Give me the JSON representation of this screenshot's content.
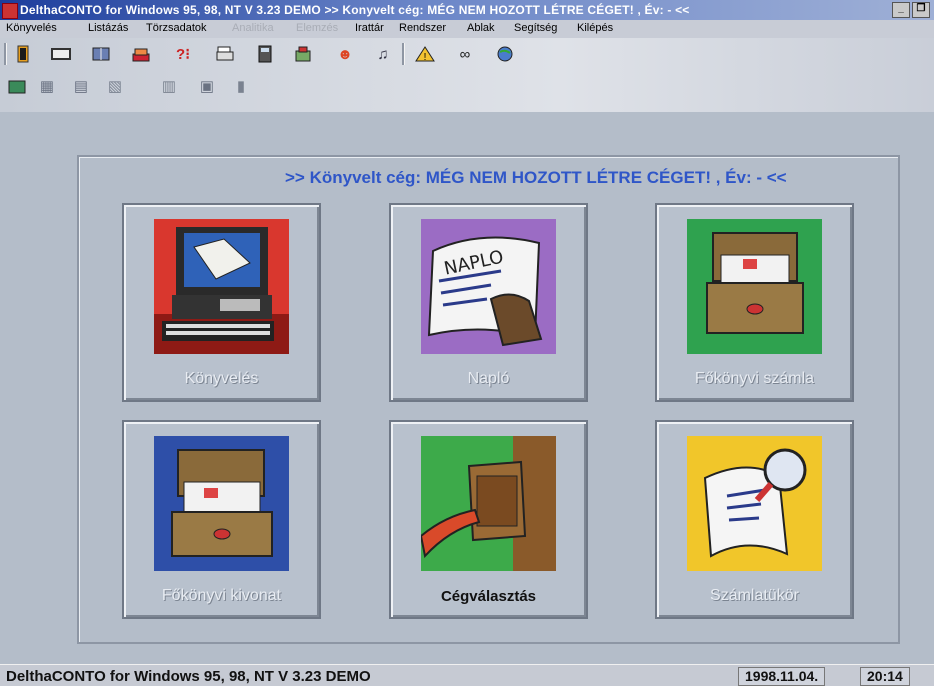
{
  "window": {
    "title": "DelthaCONTO for Windows 95, 98, NT   V 3.23 DEMO   >> Konyvelt cég:  MÉG NEM HOZOTT LÉTRE CÉGET! ,  Év: - <<"
  },
  "menu": [
    {
      "label": "Könyvelés",
      "enabled": true
    },
    {
      "label": "Listázás",
      "enabled": true
    },
    {
      "label": "Törzsadatok",
      "enabled": true
    },
    {
      "label": "Analitika",
      "enabled": false
    },
    {
      "label": "Elemzés",
      "enabled": false
    },
    {
      "label": "Irattár",
      "enabled": true
    },
    {
      "label": "Rendszer",
      "enabled": true
    },
    {
      "label": "Ablak",
      "enabled": true
    },
    {
      "label": "Segítség",
      "enabled": true
    },
    {
      "label": "Kilépés",
      "enabled": true
    }
  ],
  "toolbar": {
    "row1_icons": [
      "door-icon",
      "rectangle-icon",
      "book-icon",
      "stack-icon",
      "help-icon",
      "printer-icon",
      "calculator-icon",
      "tools-icon",
      "smile-icon",
      "music-icon",
      "warning-icon",
      "glasses-icon",
      "globe-icon"
    ],
    "row2_icons": [
      "folder-icon",
      "grid-icon",
      "doc-icon",
      "chart-icon",
      "table-icon",
      "bar-chart-icon"
    ]
  },
  "main": {
    "header": ">> Könyvelt cég:  MÉG NEM HOZOTT LÉTRE CÉGET! ,   Év: - <<"
  },
  "tiles": [
    {
      "label": "Könyvelés",
      "active": false
    },
    {
      "label": "Napló",
      "active": false
    },
    {
      "label": "Főkönyvi számla",
      "active": false
    },
    {
      "label": "Főkönyvi kivonat",
      "active": false
    },
    {
      "label": "Cégválasztás",
      "active": true
    },
    {
      "label": "Számlatükör",
      "active": false
    }
  ],
  "statusbar": {
    "app_text": "DelthaCONTO for Windows 95, 98, NT   V 3.23 DEMO",
    "date": "1998.11.04.",
    "time": "20:14"
  }
}
